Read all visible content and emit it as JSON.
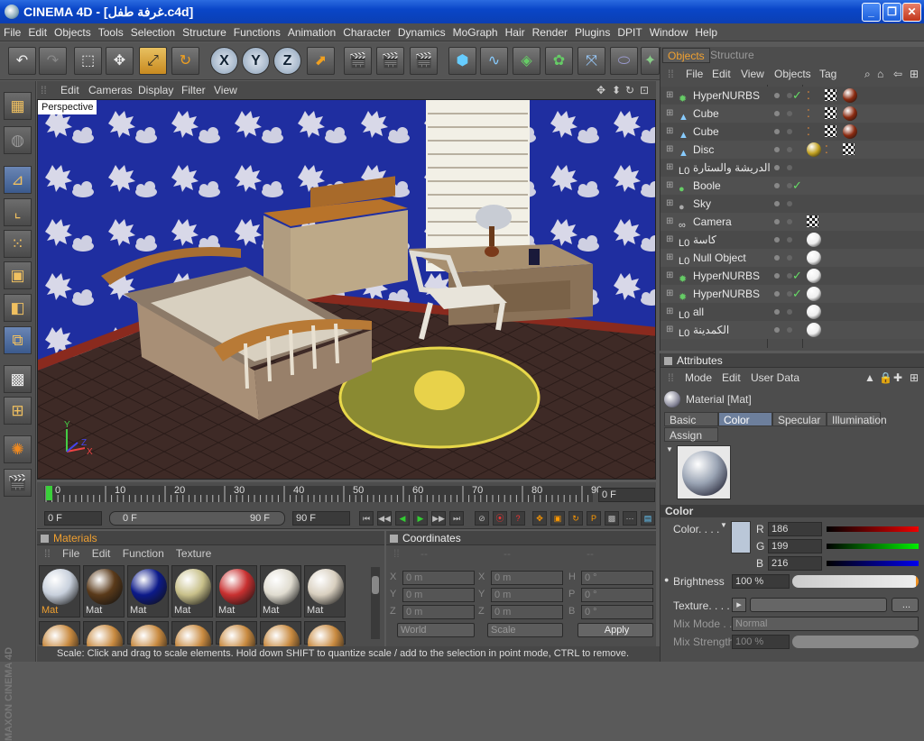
{
  "window": {
    "title": "CINEMA 4D - [غرفة طفل.c4d]"
  },
  "menu": [
    "File",
    "Edit",
    "Objects",
    "Tools",
    "Selection",
    "Structure",
    "Functions",
    "Animation",
    "Character",
    "Dynamics",
    "MoGraph",
    "Hair",
    "Render",
    "Plugins",
    "DPIT",
    "Window",
    "Help"
  ],
  "viewport": {
    "menu": [
      "Edit",
      "Cameras",
      "Display",
      "Filter",
      "View"
    ],
    "label": "Perspective"
  },
  "timeline": {
    "ticks": [
      "0",
      "10",
      "20",
      "30",
      "40",
      "50",
      "60",
      "70",
      "80",
      "90"
    ],
    "current_frame": "0 F"
  },
  "playback": {
    "start": "0 F",
    "range_start": "0 F",
    "range_end": "90 F",
    "end": "90 F"
  },
  "materials": {
    "title": "Materials",
    "menu": [
      "File",
      "Edit",
      "Function",
      "Texture"
    ],
    "items": [
      {
        "label": "Mat",
        "color": "#c8d0dc"
      },
      {
        "label": "Mat",
        "color": "#5a3a1a"
      },
      {
        "label": "Mat",
        "color": "#0c1a8a"
      },
      {
        "label": "Mat",
        "color": "#c8c08a"
      },
      {
        "label": "Mat",
        "color": "#c83030"
      },
      {
        "label": "Mat",
        "color": "#e0dcd0"
      },
      {
        "label": "Mat",
        "color": "#d8cfbf"
      }
    ]
  },
  "coordinates": {
    "title": "Coordinates",
    "rows": [
      {
        "a": "X",
        "av": "0 m",
        "b": "X",
        "bv": "0 m",
        "c": "H",
        "cv": "0 °"
      },
      {
        "a": "Y",
        "av": "0 m",
        "b": "Y",
        "bv": "0 m",
        "c": "P",
        "cv": "0 °"
      },
      {
        "a": "Z",
        "av": "0 m",
        "b": "Z",
        "bv": "0 m",
        "c": "B",
        "cv": "0 °"
      }
    ],
    "mode1": "World",
    "mode2": "Scale",
    "apply": "Apply"
  },
  "objects_panel": {
    "tabs": [
      "Objects",
      "Structure"
    ],
    "menu": [
      "File",
      "Edit",
      "View",
      "Objects",
      "Tag"
    ],
    "items": [
      {
        "name": "HyperNURBS",
        "icon": "hypernurbs",
        "check": true
      },
      {
        "name": "Cube",
        "icon": "cube",
        "check": false
      },
      {
        "name": "Cube",
        "icon": "cube",
        "check": false
      },
      {
        "name": "Disc",
        "icon": "disc",
        "check": false
      },
      {
        "name": "الدريشة والستارة",
        "icon": "null",
        "check": false
      },
      {
        "name": "Boole",
        "icon": "boole",
        "check": true
      },
      {
        "name": "Sky",
        "icon": "sky",
        "check": false
      },
      {
        "name": "Camera",
        "icon": "camera",
        "check": false
      },
      {
        "name": "كاسة",
        "icon": "null",
        "check": false
      },
      {
        "name": "Null Object",
        "icon": "null",
        "check": false
      },
      {
        "name": "HyperNURBS",
        "icon": "hypernurbs",
        "check": true
      },
      {
        "name": "HyperNURBS",
        "icon": "hypernurbs",
        "check": true
      },
      {
        "name": "all",
        "icon": "null",
        "check": false
      },
      {
        "name": "الكمدينة",
        "icon": "null",
        "check": false
      }
    ]
  },
  "attributes": {
    "title": "Attributes",
    "menu": [
      "Mode",
      "Edit",
      "User Data"
    ],
    "material_name": "Material [Mat]",
    "tabs": [
      "Basic",
      "Color",
      "Specular",
      "Illumination",
      "Assign"
    ],
    "section": "Color",
    "color_label": "Color. . . .",
    "r_label": "R",
    "r": "186",
    "g_label": "G",
    "g": "199",
    "b_label": "B",
    "b": "216",
    "brightness_label": "Brightness",
    "brightness": "100 %",
    "texture_label": "Texture. . . .",
    "mixmode_label": "Mix Mode . .",
    "mixmode": "Normal",
    "mixstrength_label": "Mix Strength",
    "mixstrength": "100 %"
  },
  "status": "Scale: Click and drag to scale elements. Hold down SHIFT to quantize scale / add to the selection in point mode, CTRL to remove.",
  "branding": "MAXON CINEMA 4D"
}
